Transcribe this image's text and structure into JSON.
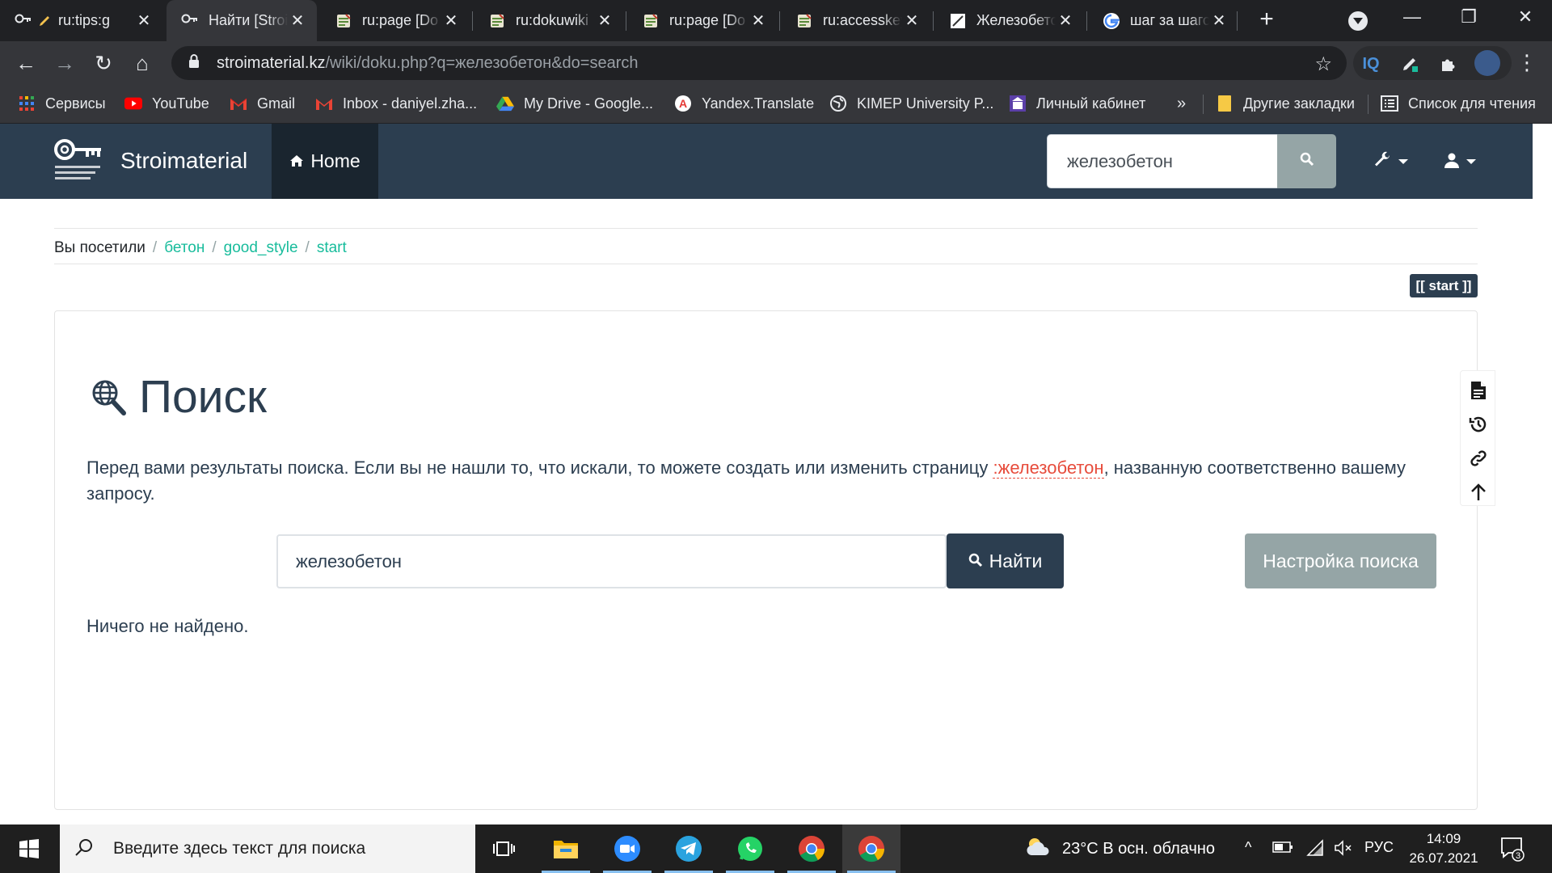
{
  "browser": {
    "tabs": [
      {
        "title": "ru:tips:g"
      },
      {
        "title": "Найти [Stroimaterial]"
      },
      {
        "title": "ru:page [Do"
      },
      {
        "title": "ru:dokuwiki"
      },
      {
        "title": "ru:page [Do"
      },
      {
        "title": "ru:accesskey"
      },
      {
        "title": "Железобетон"
      },
      {
        "title": "шаг за шагом"
      }
    ],
    "new_tab_label": "+",
    "url_host": "stroimaterial.kz",
    "url_rest": "/wiki/doku.php?q=железобетон&do=search",
    "extension_iq_label": "IQ"
  },
  "bookmarks": {
    "items": [
      {
        "label": "Сервисы"
      },
      {
        "label": "YouTube"
      },
      {
        "label": "Gmail"
      },
      {
        "label": "Inbox - daniyel.zha..."
      },
      {
        "label": "My Drive - Google..."
      },
      {
        "label": "Yandex.Translate"
      },
      {
        "label": "KIMEP University P..."
      },
      {
        "label": "Личный кабинет"
      }
    ],
    "overflow_label": "»",
    "other_label": "Другие закладки",
    "reading_list_label": "Список для чтения"
  },
  "site": {
    "brand": "Stroimaterial",
    "home_label": "Home",
    "nav_search_value": "железобетон",
    "breadcrumb": {
      "label": "Вы посетили",
      "items": [
        "бетон",
        "good_style",
        "start"
      ]
    },
    "page_id_badge": "[[ start ]]"
  },
  "main": {
    "title": "Поиск",
    "intro_before": "Перед вами результаты поиска. Если вы не нашли то, что искали, то можете создать или изменить страницу ",
    "intro_link": ":железобетон",
    "intro_after": ", названную соответственно вашему запросу.",
    "search_value": "железобетон",
    "search_button": "Найти",
    "advanced_button": "Настройка поиска",
    "no_results": "Ничего не найдено."
  },
  "taskbar": {
    "search_placeholder": "Введите здесь текст для поиска",
    "weather": "23°C  В осн. облачно",
    "lang": "РУС",
    "time": "14:09",
    "date": "26.07.2021",
    "notification_count": "3"
  },
  "colors": {
    "navbar": "#2c3e50",
    "accent_link": "#18bc9c",
    "wanted_link": "#e74c3c",
    "secondary_button": "#95a5a6"
  }
}
